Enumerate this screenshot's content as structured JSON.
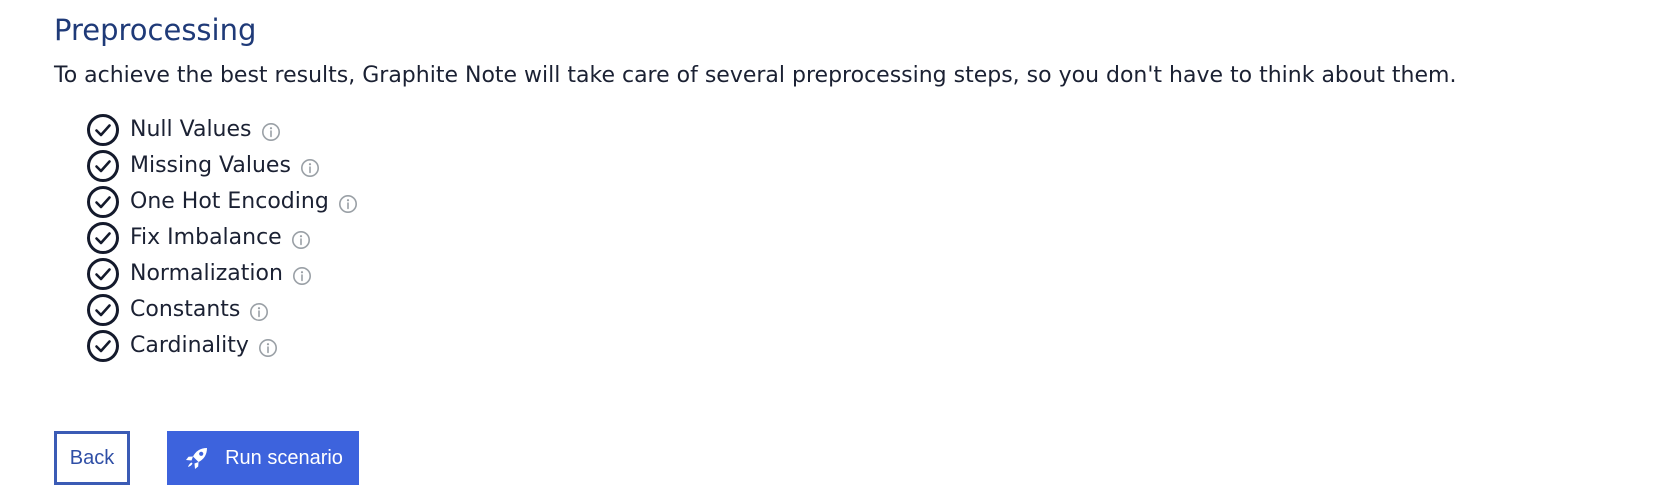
{
  "page": {
    "title": "Preprocessing",
    "intro": "To achieve the best results, Graphite Note will take care of several preprocessing steps, so you don't have to think about them."
  },
  "steps": [
    {
      "label": "Null Values",
      "checked": true
    },
    {
      "label": "Missing Values",
      "checked": true
    },
    {
      "label": "One Hot Encoding",
      "checked": true
    },
    {
      "label": "Fix Imbalance",
      "checked": true
    },
    {
      "label": "Normalization",
      "checked": true
    },
    {
      "label": "Constants",
      "checked": true
    },
    {
      "label": "Cardinality",
      "checked": true
    }
  ],
  "buttons": {
    "back_label": "Back",
    "run_label": "Run scenario"
  },
  "icons": {
    "step_icon": "check-circle-icon",
    "info_icon": "info-icon",
    "run_icon": "rocket-icon"
  },
  "colors": {
    "title": "#1f3a78",
    "text": "#1b2133",
    "accent": "#3d63dd",
    "back_border": "#3b5bb5",
    "info_icon": "#9aa0a6"
  }
}
